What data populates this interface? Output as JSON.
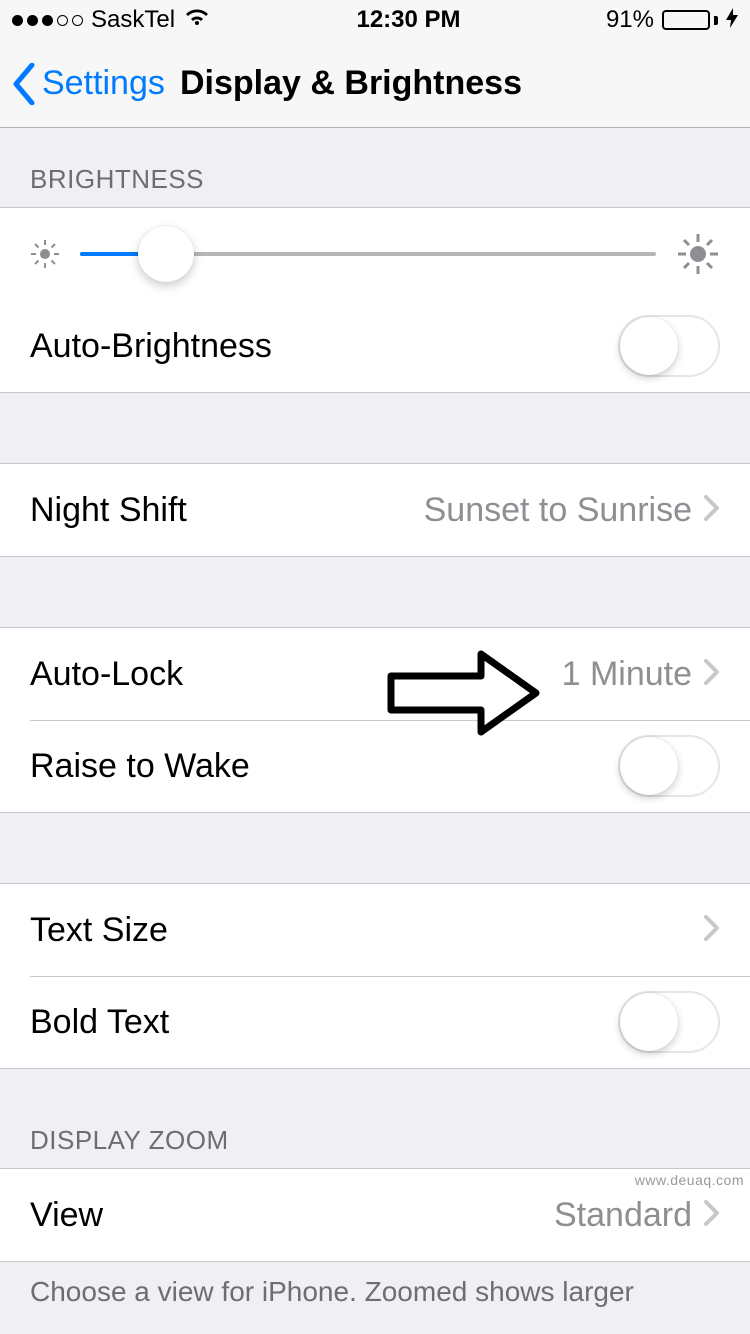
{
  "status": {
    "carrier": "SaskTel",
    "time": "12:30 PM",
    "battery_pct": "91%"
  },
  "nav": {
    "back_label": "Settings",
    "title": "Display & Brightness"
  },
  "sections": {
    "brightness_header": "BRIGHTNESS",
    "auto_brightness_label": "Auto-Brightness",
    "night_shift_label": "Night Shift",
    "night_shift_value": "Sunset to Sunrise",
    "auto_lock_label": "Auto-Lock",
    "auto_lock_value": "1 Minute",
    "raise_to_wake_label": "Raise to Wake",
    "text_size_label": "Text Size",
    "bold_text_label": "Bold Text",
    "display_zoom_header": "DISPLAY ZOOM",
    "view_label": "View",
    "view_value": "Standard",
    "footer_note": "Choose a view for iPhone. Zoomed shows larger"
  },
  "slider": {
    "brightness_percent": 15
  },
  "toggles": {
    "auto_brightness": false,
    "raise_to_wake": false,
    "bold_text": false
  },
  "watermark": "www.deuaq.com"
}
